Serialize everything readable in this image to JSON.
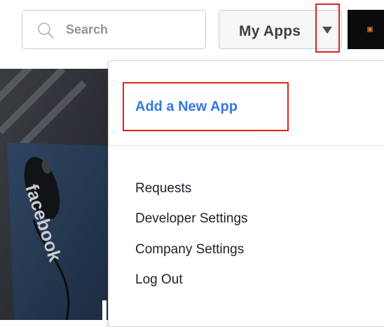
{
  "topbar": {
    "search": {
      "placeholder": "Search",
      "icon": "search-icon"
    },
    "apps_button": {
      "label": "My Apps",
      "caret_icon": "caret-down-icon"
    },
    "account": {
      "icon": "app-thumbnail-icon"
    }
  },
  "dropdown": {
    "primary_action": "Add a New App",
    "items": [
      {
        "label": "Requests"
      },
      {
        "label": "Developer Settings"
      },
      {
        "label": "Company Settings"
      },
      {
        "label": "Log Out"
      }
    ]
  },
  "colors": {
    "link": "#3578e5",
    "highlight": "#e02020",
    "text": "#1d2129"
  }
}
